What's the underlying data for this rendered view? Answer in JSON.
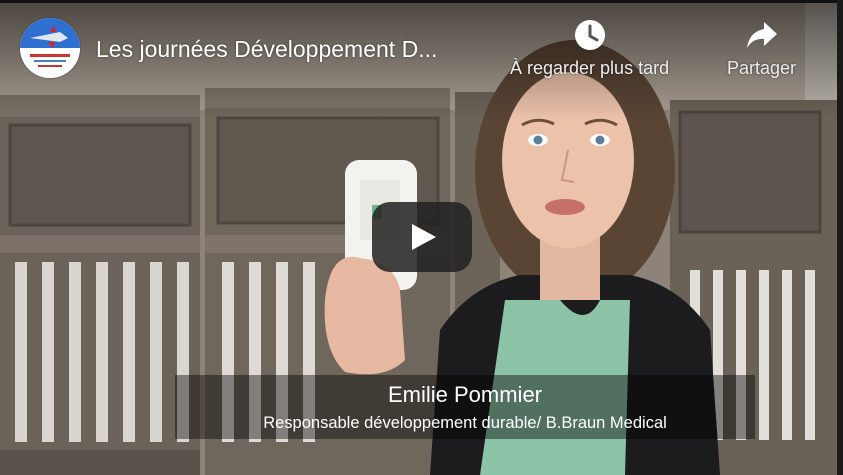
{
  "video": {
    "title": "Les journées Développement D...",
    "channel_avatar_icon": "channel-logo-icon"
  },
  "actions": {
    "watch_later": {
      "label": "À regarder plus tard",
      "icon": "clock-icon"
    },
    "share": {
      "label": "Partager",
      "icon": "share-arrow-icon"
    }
  },
  "player": {
    "play_icon": "play-icon",
    "play_button_color": "#212121"
  },
  "caption": {
    "name": "Emilie Pommier",
    "role": "Responsable développement durable/ B.Braun Medical"
  }
}
